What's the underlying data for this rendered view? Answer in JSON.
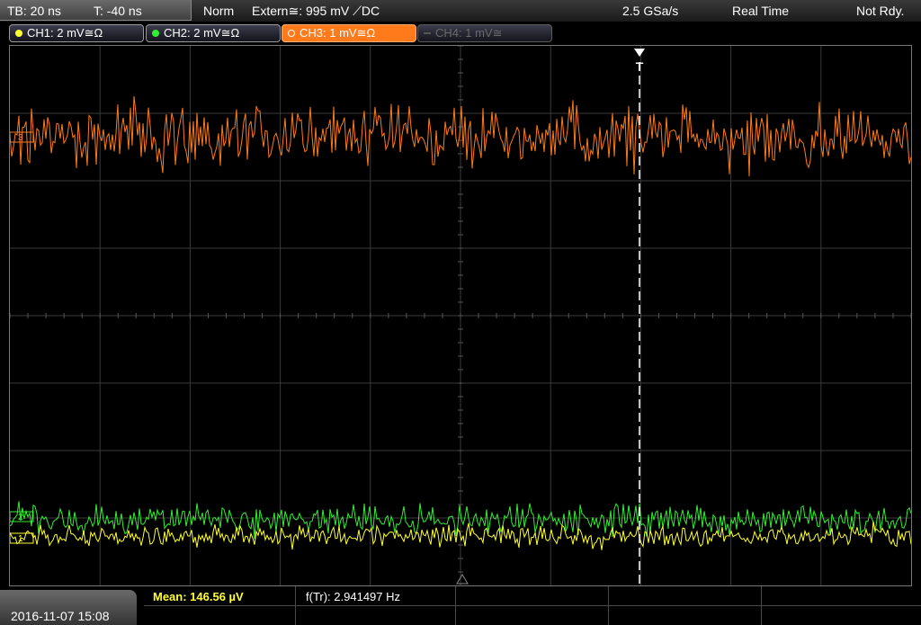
{
  "status": {
    "timebase": "TB: 20 ns",
    "trigger_time": "T: -40 ns",
    "mode": "Norm",
    "trigger_source": "Extern≅: 995 mV ⟋DC",
    "sample_rate": "2.5 GSa/s",
    "acq_mode": "Real Time",
    "trigger_state": "Not Rdy."
  },
  "channels": [
    {
      "label": "CH1: 2 mV≅Ω",
      "color": "#ffff33"
    },
    {
      "label": "CH2: 2 mV≅Ω",
      "color": "#33ee33"
    },
    {
      "label": "CH3: 1 mV≅Ω",
      "color": "#ff7a1a"
    },
    {
      "label": "CH4: 1 mV≅",
      "color": "#555555"
    }
  ],
  "markers": {
    "trigger": "T",
    "ch3_marker": "3",
    "ch2_marker": "2",
    "ch1_marker": "1"
  },
  "bottom": {
    "datetime": "2016-11-07 15:08",
    "mean": "Mean: 146.56 µV",
    "freq": "f(Tr): 2.941497 Hz"
  },
  "colors": {
    "grid": "#3a3a3a",
    "ch1": "#ffff33",
    "ch2": "#33ee33",
    "ch3": "#ff7a1a",
    "mean_text": "#ffff33"
  }
}
